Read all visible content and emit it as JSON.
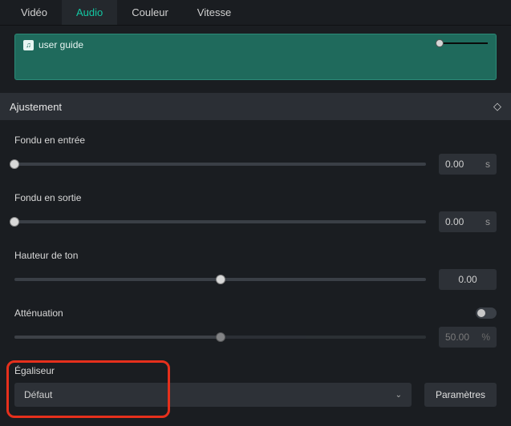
{
  "tabs": {
    "video": "Vidéo",
    "audio": "Audio",
    "color": "Couleur",
    "speed": "Vitesse",
    "active": "audio"
  },
  "clip": {
    "name": "user guide"
  },
  "section": {
    "title": "Ajustement"
  },
  "fade_in": {
    "label": "Fondu en entrée",
    "value": "0.00",
    "unit": "s",
    "position_pct": 0
  },
  "fade_out": {
    "label": "Fondu en sortie",
    "value": "0.00",
    "unit": "s",
    "position_pct": 0
  },
  "pitch": {
    "label": "Hauteur de ton",
    "value": "0.00",
    "position_pct": 50
  },
  "attenuation": {
    "label": "Atténuation",
    "value": "50.00",
    "unit": "%",
    "enabled": false,
    "position_pct": 50
  },
  "equalizer": {
    "label": "Égaliseur",
    "selected": "Défaut",
    "button": "Paramètres"
  }
}
